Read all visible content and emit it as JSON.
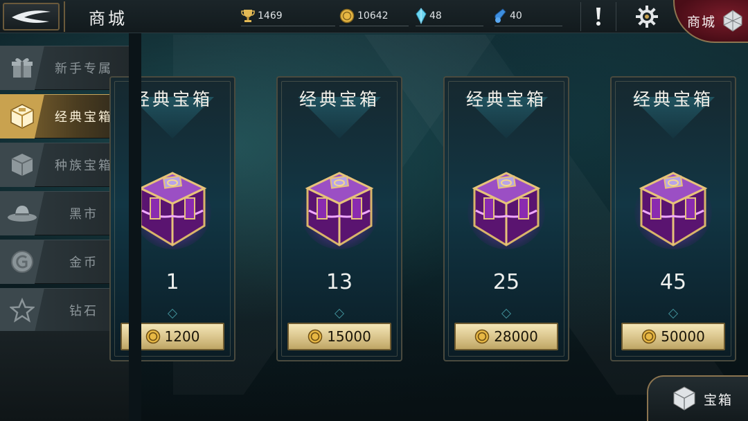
{
  "header": {
    "title": "商城",
    "resources": [
      {
        "icon": "trophy-icon",
        "value": "1469"
      },
      {
        "icon": "gold-coin-icon",
        "value": "10642"
      },
      {
        "icon": "crystal-icon",
        "value": "48"
      },
      {
        "icon": "potion-icon",
        "value": "40"
      }
    ],
    "shop_badge_label": "商城"
  },
  "sidebar": {
    "items": [
      {
        "label": "新手专属",
        "icon": "gift-icon",
        "active": false
      },
      {
        "label": "经典宝箱",
        "icon": "chest-icon",
        "active": true
      },
      {
        "label": "种族宝箱",
        "icon": "race-chest-icon",
        "active": false
      },
      {
        "label": "黑市",
        "icon": "hat-icon",
        "active": false
      },
      {
        "label": "金币",
        "icon": "coin-icon",
        "active": false
      },
      {
        "label": "钻石",
        "icon": "star-icon",
        "active": false
      }
    ]
  },
  "cards": [
    {
      "title": "经典宝箱",
      "count": "1",
      "price": "1200"
    },
    {
      "title": "经典宝箱",
      "count": "13",
      "price": "15000"
    },
    {
      "title": "经典宝箱",
      "count": "25",
      "price": "28000"
    },
    {
      "title": "经典宝箱",
      "count": "45",
      "price": "50000"
    }
  ],
  "bottom_nav": {
    "label": "宝箱"
  },
  "colors": {
    "accent_gold": "#c9a24f",
    "chest_purple": "#9b2fbf",
    "frame_bronze": "#8c7550"
  }
}
